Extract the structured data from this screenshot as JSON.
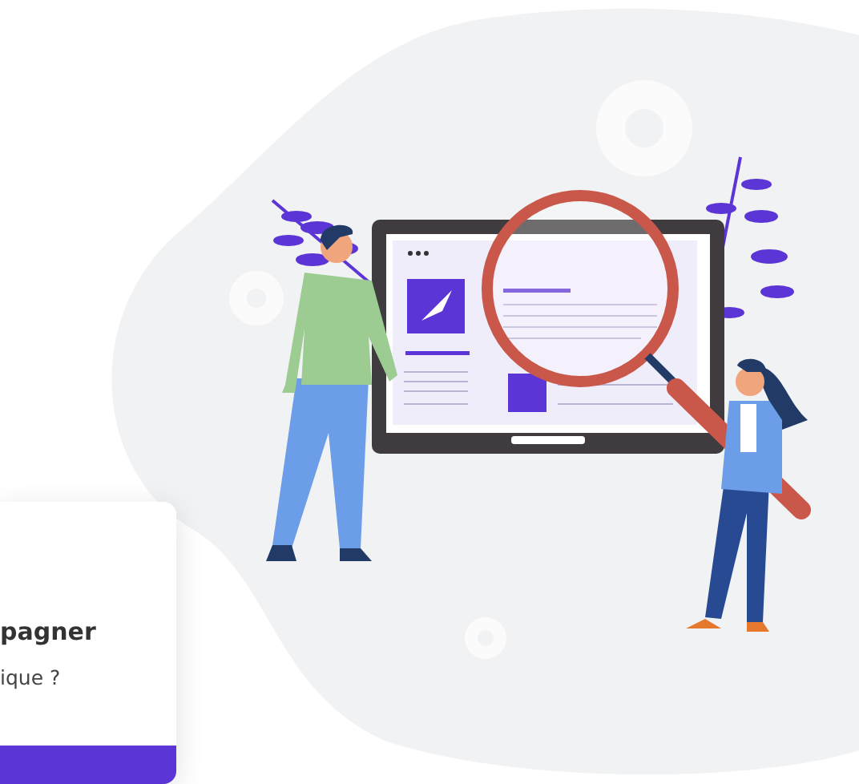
{
  "card": {
    "title": "pagner",
    "subtitle": "ique ?"
  }
}
